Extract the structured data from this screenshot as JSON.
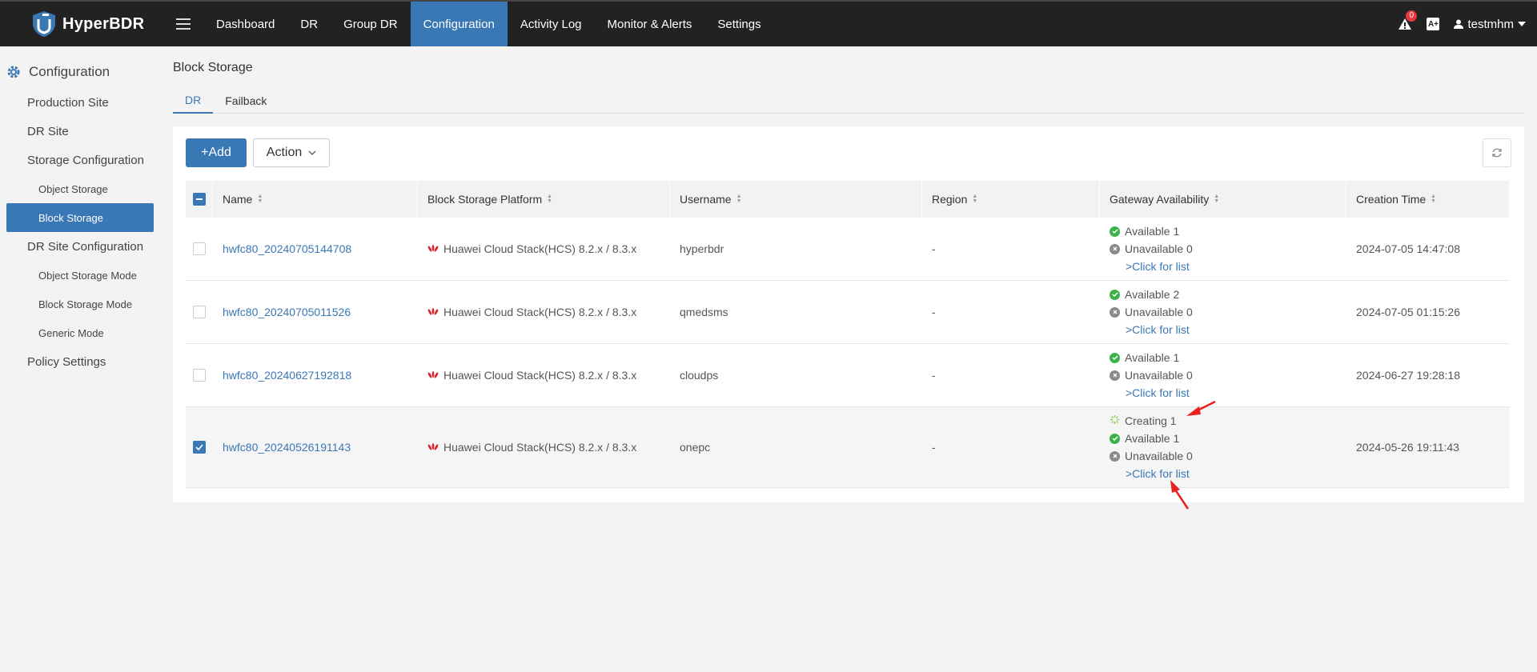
{
  "brand": {
    "name": "HyperBDR"
  },
  "nav": {
    "items": [
      {
        "label": "Dashboard",
        "active": false
      },
      {
        "label": "DR",
        "active": false
      },
      {
        "label": "Group DR",
        "active": false
      },
      {
        "label": "Configuration",
        "active": true
      },
      {
        "label": "Activity Log",
        "active": false
      },
      {
        "label": "Monitor & Alerts",
        "active": false
      },
      {
        "label": "Settings",
        "active": false
      }
    ],
    "alert_count": "0",
    "lang_icon": "A+",
    "user": "testmhm"
  },
  "sidebar": {
    "header": "Configuration",
    "items": [
      {
        "label": "Production Site"
      },
      {
        "label": "DR Site"
      },
      {
        "label": "Storage Configuration"
      },
      {
        "label": "Object Storage"
      },
      {
        "label": "Block Storage"
      },
      {
        "label": "DR Site Configuration"
      },
      {
        "label": "Object Storage Mode"
      },
      {
        "label": "Block Storage Mode"
      },
      {
        "label": "Generic Mode"
      },
      {
        "label": "Policy Settings"
      }
    ]
  },
  "page": {
    "title": "Block Storage",
    "tabs": [
      {
        "label": "DR",
        "active": true
      },
      {
        "label": "Failback",
        "active": false
      }
    ]
  },
  "toolbar": {
    "add_label": "+Add",
    "action_label": "Action"
  },
  "table": {
    "headers": [
      "Name",
      "Block Storage Platform",
      "Username",
      "Region",
      "Gateway Availability",
      "Creation Time"
    ],
    "rows": [
      {
        "name": "hwfc80_20240705144708",
        "platform": "Huawei Cloud Stack(HCS) 8.2.x / 8.3.x",
        "username": "hyperbdr",
        "region": "-",
        "creating": "",
        "available": "Available 1",
        "unavailable": "Unavailable 0",
        "list_link": ">Click for list",
        "created": "2024-07-05 14:47:08",
        "checked": false
      },
      {
        "name": "hwfc80_20240705011526",
        "platform": "Huawei Cloud Stack(HCS) 8.2.x / 8.3.x",
        "username": "qmedsms",
        "region": "-",
        "creating": "",
        "available": "Available 2",
        "unavailable": "Unavailable 0",
        "list_link": ">Click for list",
        "created": "2024-07-05 01:15:26",
        "checked": false
      },
      {
        "name": "hwfc80_20240627192818",
        "platform": "Huawei Cloud Stack(HCS) 8.2.x / 8.3.x",
        "username": "cloudps",
        "region": "-",
        "creating": "",
        "available": "Available 1",
        "unavailable": "Unavailable 0",
        "list_link": ">Click for list",
        "created": "2024-06-27 19:28:18",
        "checked": false
      },
      {
        "name": "hwfc80_20240526191143",
        "platform": "Huawei Cloud Stack(HCS) 8.2.x / 8.3.x",
        "username": "onepc",
        "region": "-",
        "creating": "Creating 1",
        "available": "Available 1",
        "unavailable": "Unavailable 0",
        "list_link": ">Click for list",
        "created": "2024-05-26 19:11:43",
        "checked": true
      }
    ]
  },
  "colors": {
    "accent": "#3a77b5",
    "topbar": "#222222",
    "ok": "#3cb34a",
    "annotation": "#e8201f"
  }
}
